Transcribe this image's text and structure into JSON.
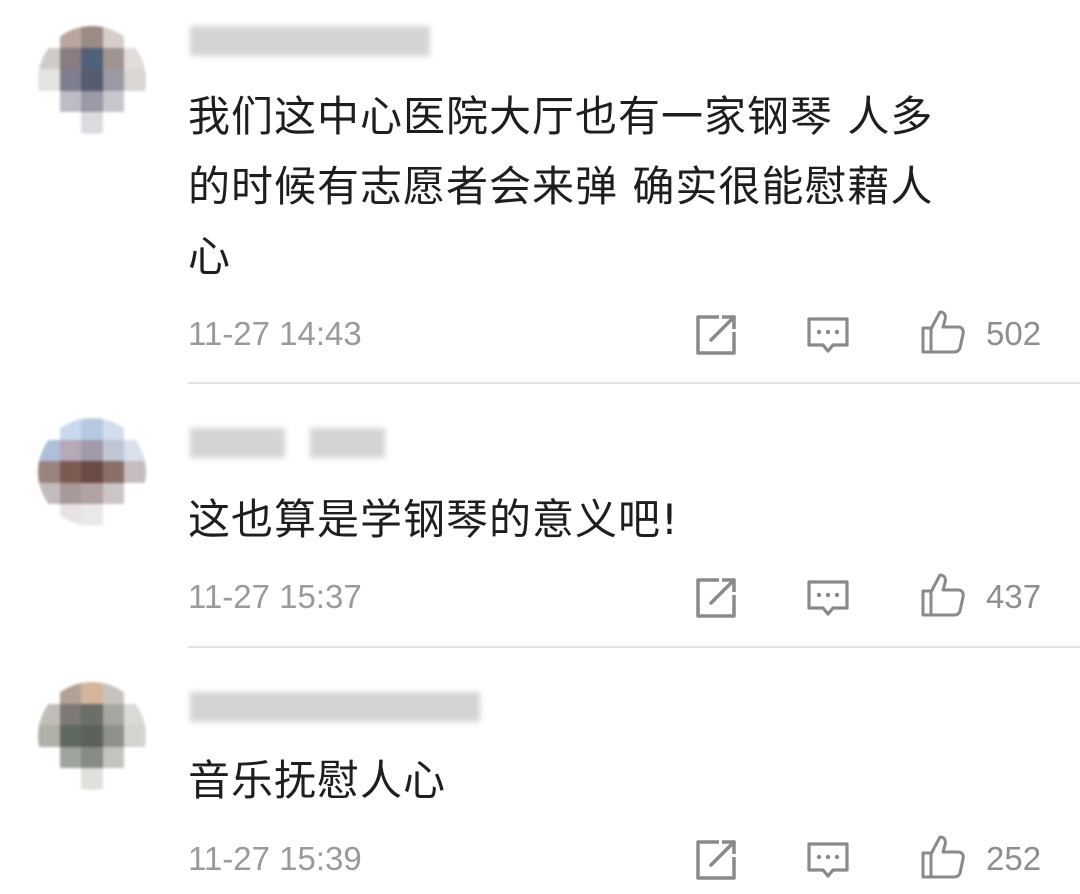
{
  "comments": [
    {
      "content": "我们这中心医院大厅也有一家钢琴 人多\n的时候有志愿者会来弹 确实很能慰藉人\n心",
      "time": "11-27 14:43",
      "likes": "502",
      "avatar_colors": [
        "#ffffff",
        "#b9a79f",
        "#9c8a85",
        "#d7cec9",
        "#ffffff",
        "#cfcbc6",
        "#8a7c80",
        "#50627b",
        "#a09491",
        "#e3ddd9",
        "#e6e2df",
        "#7d7f8e",
        "#565c70",
        "#9b9aa4",
        "#d9d6d4",
        "#ffffff",
        "#bdbcc4",
        "#9a9aa6",
        "#c7c6cd",
        "#ffffff",
        "#ffffff",
        "#ffffff",
        "#dcdbe0",
        "#ffffff",
        "#ffffff"
      ]
    },
    {
      "content": "这也算是学钢琴的意义吧!",
      "time": "11-27 15:37",
      "likes": "437",
      "avatar_colors": [
        "#ffffff",
        "#c9d8ec",
        "#b7c9e2",
        "#d2dced",
        "#ffffff",
        "#aebfd8",
        "#b6aab9",
        "#a19aa8",
        "#c0c6d5",
        "#d9e0ec",
        "#9a8480",
        "#7b5a52",
        "#6d4a44",
        "#8c7068",
        "#c4bcbf",
        "#c3bcbe",
        "#a99a9a",
        "#b1a3a3",
        "#cbc5c6",
        "#ffffff",
        "#ffffff",
        "#e7e3e3",
        "#ebe8e8",
        "#ffffff",
        "#ffffff"
      ]
    },
    {
      "content": "音乐抚慰人心",
      "time": "11-27 15:39",
      "likes": "252",
      "avatar_colors": [
        "#ffffff",
        "#b1a197",
        "#d3b59e",
        "#c9c3bf",
        "#ffffff",
        "#c2bdb7",
        "#7d7a75",
        "#6a6f67",
        "#a8a6a0",
        "#dcd9d5",
        "#b3b0aa",
        "#5f6860",
        "#5a6259",
        "#8e918a",
        "#d5d3cf",
        "#ffffff",
        "#9fa49c",
        "#868b84",
        "#c4c4bf",
        "#ffffff",
        "#ffffff",
        "#ffffff",
        "#e1e0dd",
        "#ffffff",
        "#ffffff"
      ]
    }
  ],
  "icons": {
    "repost": "share-edit-icon",
    "reply": "comment-bubble-icon",
    "like": "thumbs-up-icon"
  },
  "colors": {
    "text": "#1e1e1e",
    "meta": "#9a9a9a",
    "icon": "#8a8a8a",
    "divider": "#e4e4e4"
  }
}
